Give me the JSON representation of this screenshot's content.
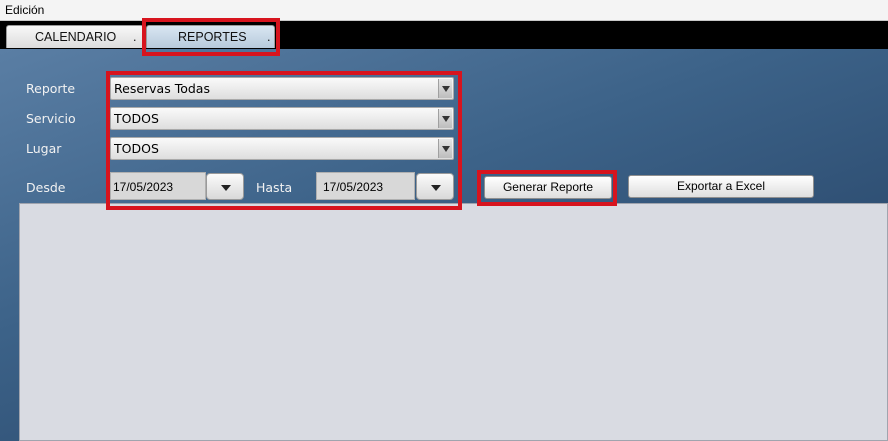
{
  "menubar": {
    "edit_label": "Edición"
  },
  "tabs": [
    {
      "label": "CALENDARIO",
      "suffix": "."
    },
    {
      "label": "REPORTES",
      "suffix": "."
    }
  ],
  "form": {
    "reporte_label": "Reporte",
    "reporte_value": "Reservas Todas",
    "servicio_label": "Servicio",
    "servicio_value": "TODOS",
    "lugar_label": "Lugar",
    "lugar_value": "TODOS",
    "desde_label": "Desde",
    "desde_value": "17/05/2023",
    "hasta_label": "Hasta",
    "hasta_value": "17/05/2023"
  },
  "buttons": {
    "generate_label": "Generar Reporte",
    "export_label": "Exportar a Excel"
  },
  "icons": {
    "combo_arrow": "chevron-down-icon",
    "date_picker": "chevron-down-icon"
  },
  "colors": {
    "highlight": "#d7141e",
    "tabstrip": "#000000",
    "panel": "#3c6288",
    "results_area": "#d9dbe2"
  }
}
